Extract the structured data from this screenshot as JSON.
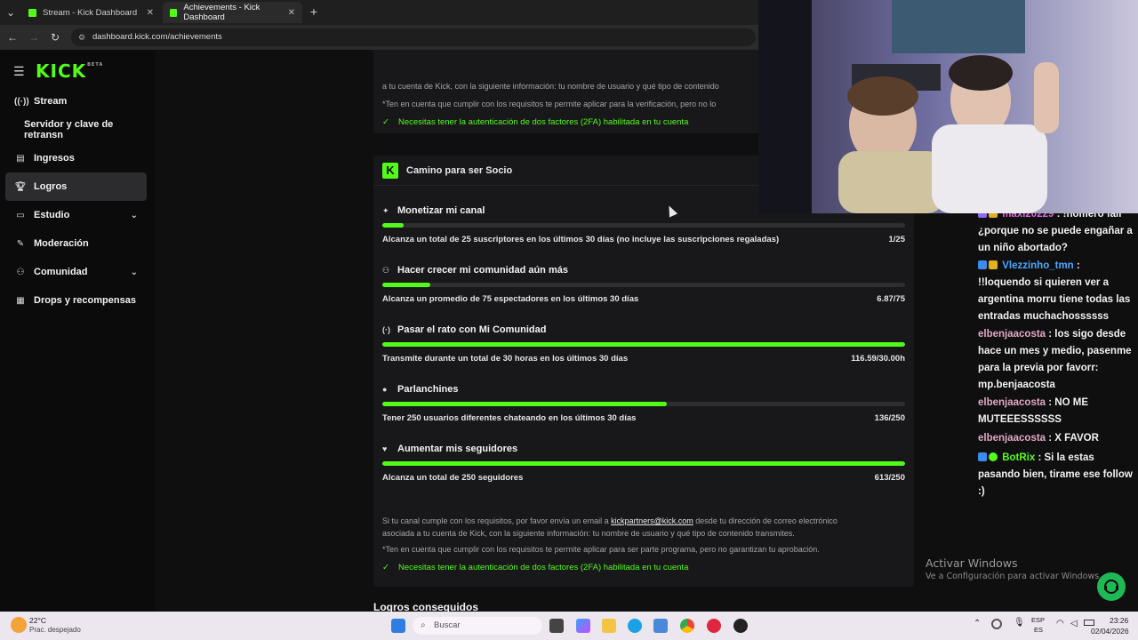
{
  "browser": {
    "tabs": [
      {
        "title": "Stream - Kick Dashboard",
        "active": false
      },
      {
        "title": "Achievements - Kick Dashboard",
        "active": true
      }
    ],
    "url": "dashboard.kick.com/achievements",
    "new_tab_symbol": "+"
  },
  "sidebar": {
    "logo": "KICK",
    "logo_badge": "BETA",
    "items": [
      {
        "label": "Stream",
        "icon": "broadcast-icon"
      },
      {
        "label": "Servidor y clave de retransn",
        "icon": ""
      },
      {
        "label": "Ingresos",
        "icon": "chart-icon"
      },
      {
        "label": "Logros",
        "icon": "trophy-icon",
        "active": true
      },
      {
        "label": "Estudio",
        "icon": "brush-icon",
        "expandable": true
      },
      {
        "label": "Moderación",
        "icon": "wrench-icon"
      },
      {
        "label": "Comunidad",
        "icon": "users-icon",
        "expandable": true
      },
      {
        "label": "Drops y recompensas",
        "icon": "gift-icon"
      }
    ]
  },
  "top_card": {
    "line1": "a tu cuenta de Kick, con la siguiente información: tu nombre de usuario y qué tipo de contenido",
    "line2": "*Ten en cuenta que cumplir con los requisitos te permite aplicar para la verificación, pero no lo",
    "requirement": "Necesitas tener la autenticación de dos factores (2FA) habilitada en tu cuenta"
  },
  "partner_card": {
    "title": "Camino para ser Socio",
    "goals": [
      {
        "title": "Monetizar mi canal",
        "icon": "sparkle-icon",
        "description": "Alcanza un total de 25 suscriptores en los últimos 30 días (no incluye las suscripciones regaladas)",
        "value": "1/25",
        "progress": 0.04
      },
      {
        "title": "Hacer crecer mi comunidad aún más",
        "icon": "people-icon",
        "description": "Alcanza un promedio de 75 espectadores en los últimos 30 días",
        "value": "6.87/75",
        "progress": 0.092
      },
      {
        "title": "Pasar el rato con Mi Comunidad",
        "icon": "broadcast-icon",
        "description": "Transmite durante un total de 30 horas en los últimos 30 días",
        "value": "116.59/30.00h",
        "progress": 1.0
      },
      {
        "title": "Parlanchines",
        "icon": "chat-icon",
        "description": "Tener 250 usuarios diferentes chateando en los últimos 30 días",
        "value": "136/250",
        "progress": 0.544
      },
      {
        "title": "Aumentar mis seguidores",
        "icon": "heart-icon",
        "description": "Alcanza un total de 250 seguidores",
        "value": "613/250",
        "progress": 1.0
      }
    ],
    "footer_pre": "Si tu canal cumple con los requisitos, por favor envía un email a ",
    "footer_email": "kickpartners@kick.com",
    "footer_post": " desde tu dirección de correo electrónico",
    "footer_line2": "asociada a tu cuenta de Kick, con la siguiente información: tu nombre de usuario y qué tipo de contenido transmites.",
    "footer_note": "*Ten en cuenta que cumplir con los requisitos te permite aplicar para ser parte programa, pero no garantizan tu aprobación.",
    "requirement": "Necesitas tener la autenticación de dos factores (2FA) habilitada en tu cuenta"
  },
  "logros_heading": "Logros conseguidos",
  "chat": [
    {
      "user": "maxi20229",
      "text": ": !homero fail ¿porque no se puede engañar a un niño abortado?",
      "color": "#d46bd6"
    },
    {
      "user": "Vlezzinho_tmn",
      "text": ": !!loquendo si quieren ver a argentina morru tiene todas las entradas muchachossssss",
      "color": "#4aa8ff"
    },
    {
      "user": "elbenjaacosta",
      "text": ": los sigo desde hace un mes y medio, pasenme para la previa por favorr: mp.benjaacosta",
      "color": "#e0a7c4"
    },
    {
      "user": "elbenjaacosta",
      "text": ": NO ME MUTEEESSSSSS",
      "color": "#e0a7c4"
    },
    {
      "user": "elbenjaacosta",
      "text": ": X FAVOR",
      "color": "#e0a7c4"
    },
    {
      "user": "BotRix",
      "text": ": Si la estas pasando bien, tirame ese follow :)",
      "color": "#53fc18"
    }
  ],
  "windows_activation": {
    "title": "Activar Windows",
    "subtitle": "Ve a Configuración para activar Windows."
  },
  "taskbar": {
    "weather_temp": "22°C",
    "weather_desc": "Prac. despejado",
    "search_placeholder": "Buscar",
    "lang_top": "ESP",
    "lang_bottom": "ES",
    "time": "23:26",
    "date": "02/04/2026"
  },
  "colors": {
    "accent": "#53fc18",
    "bg": "#0f0f10",
    "card": "#18181a"
  }
}
